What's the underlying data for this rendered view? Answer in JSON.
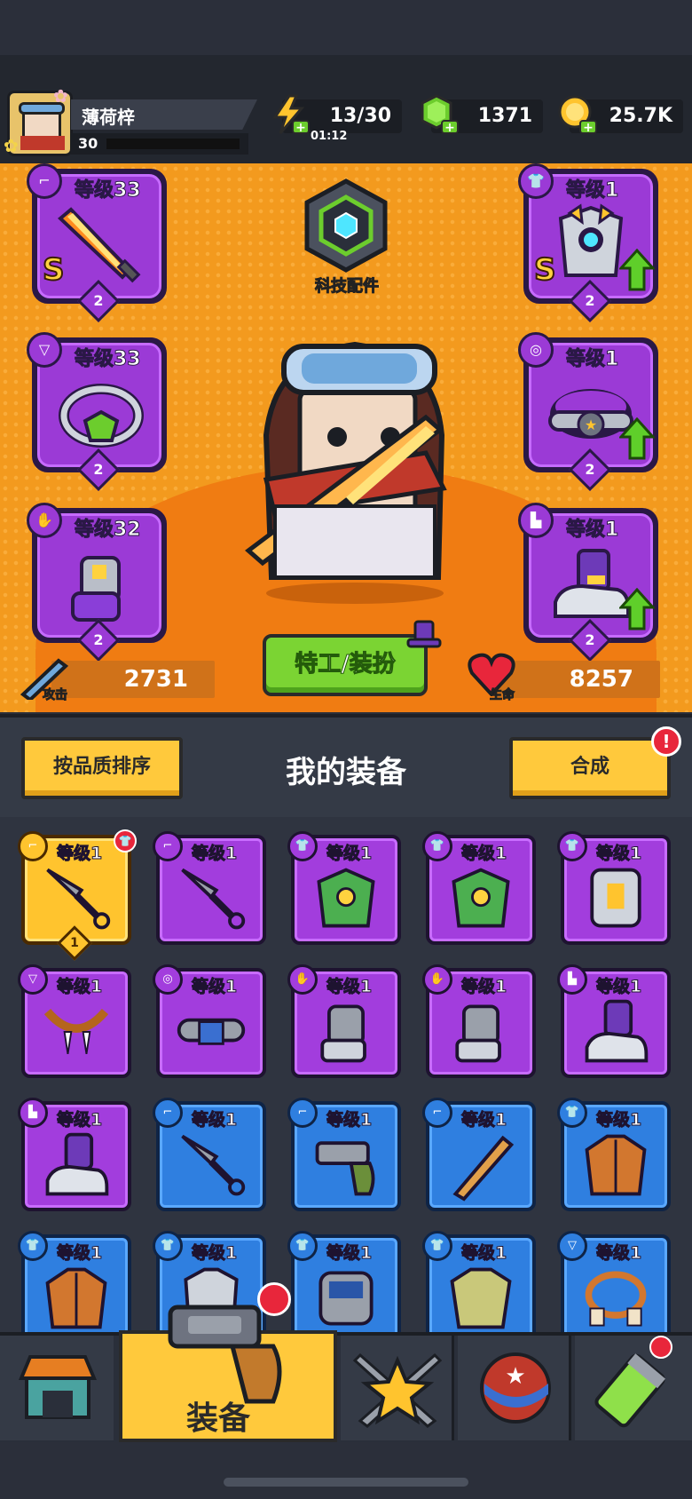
{
  "player": {
    "name": "薄荷梓",
    "level": "30"
  },
  "resources": {
    "energy": "13/30",
    "energy_timer": "01:12",
    "gems": "1371",
    "coins": "25.7K"
  },
  "tech": {
    "label": "科技配件"
  },
  "slots": {
    "weapon": {
      "level": "等级33",
      "rank": "S",
      "count": "2"
    },
    "necklace": {
      "level": "等级33",
      "count": "2"
    },
    "glove": {
      "level": "等级32",
      "count": "2"
    },
    "armor": {
      "level": "等级1",
      "rank": "S",
      "count": "2"
    },
    "belt": {
      "level": "等级1",
      "count": "2"
    },
    "boots": {
      "level": "等级1",
      "count": "2"
    }
  },
  "costume_button": "特工/装扮",
  "stats": {
    "attack_label": "攻击",
    "attack": "2731",
    "hp_label": "生命",
    "hp": "8257"
  },
  "toolbar": {
    "sort": "按品质排序",
    "title": "我的装备",
    "merge": "合成",
    "merge_alert": "!"
  },
  "inventory_level": "等级1",
  "inventory_first_count": "1",
  "nav": {
    "active_label": "装备"
  },
  "colors": {
    "panel": "#f39a1e",
    "epic": "#a23ddd",
    "rare": "#2f7fe0",
    "legend": "#ffc42e"
  }
}
